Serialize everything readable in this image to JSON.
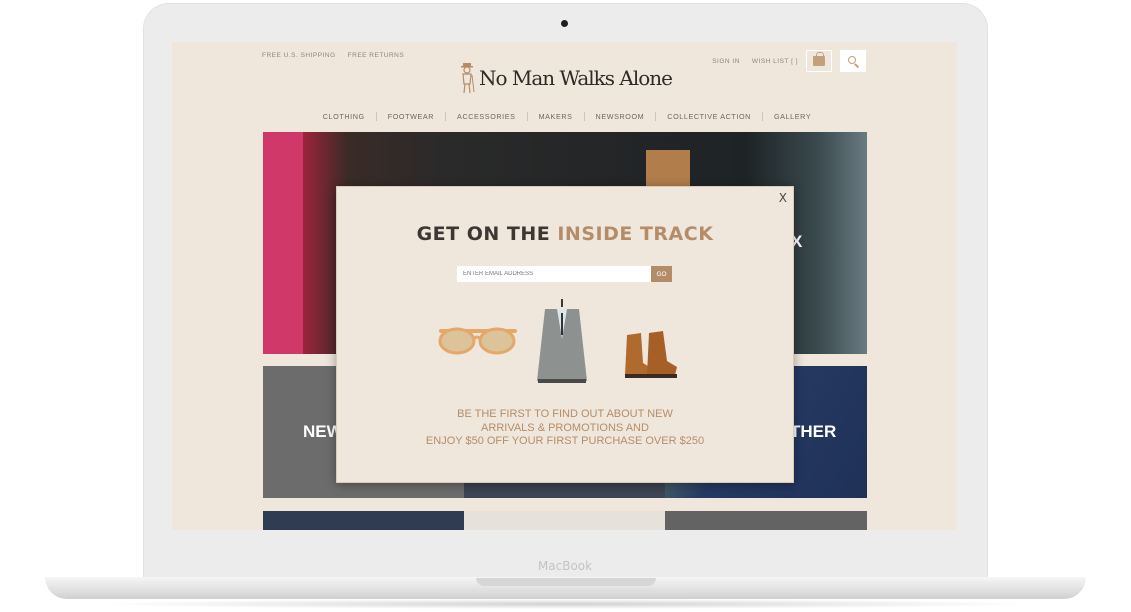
{
  "device": {
    "brand_label": "MacBook"
  },
  "site": {
    "topbar": {
      "shipping": "FREE U.S. SHIPPING",
      "returns": "FREE RETURNS",
      "sign_in": "SIGN IN",
      "wish_list": "WISH LIST [ ]"
    },
    "logo_text": "No Man Walks Alone",
    "nav": [
      "CLOTHING",
      "FOOTWEAR",
      "ACCESSORIES",
      "MAKERS",
      "NEWSROOM",
      "COLLECTIVE ACTION",
      "GALLERY"
    ],
    "hero_partial_text": "X",
    "tile_left_partial_text": "NEW",
    "tile_right_partial_text": "THER"
  },
  "modal": {
    "title_part1": "GET ON THE ",
    "title_accent": "INSIDE TRACK",
    "email_placeholder": "ENTER EMAIL ADDRESS",
    "go_label": "GO",
    "close_label": "X",
    "promo_line1": "BE THE FIRST TO FIND OUT ABOUT NEW",
    "promo_line2": "ARRIVALS & PROMOTIONS AND",
    "promo_line3": "ENJOY $50 OFF YOUR FIRST PURCHASE OVER $250"
  },
  "colors": {
    "accent": "#b48d68",
    "page_bg": "#efe7dc",
    "text_dark": "#3b3733"
  },
  "icons": [
    "shopping-bag-icon",
    "search-icon",
    "close-icon",
    "gentleman-logo-icon"
  ]
}
